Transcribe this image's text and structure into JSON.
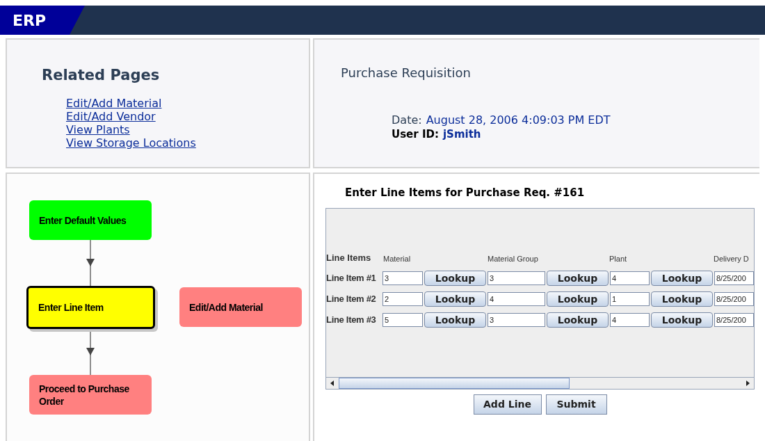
{
  "header": {
    "logo": "ERP"
  },
  "related_pages": {
    "title": "Related Pages",
    "links": [
      "Edit/Add Material",
      "Edit/Add Vendor",
      "View Plants",
      "View Storage Locations"
    ]
  },
  "requisition": {
    "title": "Purchase Requisition",
    "date_label": "Date:",
    "date": "August 28, 2006 4:09:03 PM EDT",
    "user_label": "User ID:",
    "user": "jSmith"
  },
  "flow": {
    "nodes": [
      {
        "label": "Enter Default Values",
        "color": "#00ff00",
        "current": false
      },
      {
        "label": "Enter Line Item",
        "color": "#ffff00",
        "current": true
      },
      {
        "label": "Edit/Add Material",
        "color": "#ff8080",
        "current": false
      },
      {
        "label": "Proceed to Purchase Order",
        "color": "#ff8080",
        "current": false
      }
    ]
  },
  "line_items": {
    "title": "Enter Line Items for Purchase Req. #161",
    "columns": [
      "Line Items",
      "Material",
      "Material Group",
      "Plant",
      "Delivery D"
    ],
    "rows": [
      {
        "label": "Line Item #1",
        "lookups": [
          "Lookup",
          "Lookup",
          "Lookup"
        ],
        "material": "3",
        "material_group": "3",
        "plant": "4",
        "delivery": "8/25/200"
      },
      {
        "label": "Line Item #2",
        "lookups": [
          "Lookup",
          "Lookup",
          "Lookup"
        ],
        "material": "2",
        "material_group": "4",
        "plant": "1",
        "delivery": "8/25/200"
      },
      {
        "label": "Line Item #3",
        "lookups": [
          "Lookup",
          "Lookup",
          "Lookup"
        ],
        "material": "5",
        "material_group": "3",
        "plant": "4",
        "delivery": "8/25/200"
      }
    ],
    "buttons": [
      "Add Line",
      "Submit"
    ]
  }
}
